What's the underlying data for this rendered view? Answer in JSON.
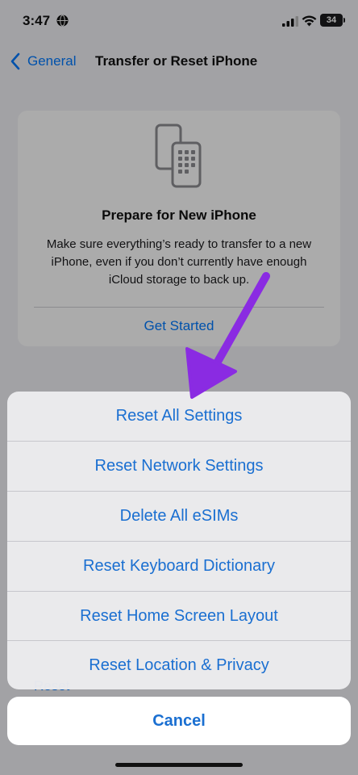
{
  "status_bar": {
    "time": "3:47",
    "battery": "34"
  },
  "nav": {
    "back_label": "General",
    "title": "Transfer or Reset iPhone"
  },
  "card": {
    "icon": "two-phones-icon",
    "title": "Prepare for New iPhone",
    "description": "Make sure everything’s ready to transfer to a new iPhone, even if you don’t currently have enough iCloud storage to back up.",
    "link": "Get Started"
  },
  "peek": {
    "reset_label": "Reset"
  },
  "action_sheet": {
    "items": [
      {
        "label": "Reset All Settings"
      },
      {
        "label": "Reset Network Settings"
      },
      {
        "label": "Delete All eSIMs"
      },
      {
        "label": "Reset Keyboard Dictionary"
      },
      {
        "label": "Reset Home Screen Layout"
      },
      {
        "label": "Reset Location & Privacy"
      }
    ],
    "cancel_label": "Cancel"
  },
  "colors": {
    "accent": "#007aff",
    "sheet_text": "#1a6fd1",
    "annotation_arrow": "#8a2be2"
  }
}
